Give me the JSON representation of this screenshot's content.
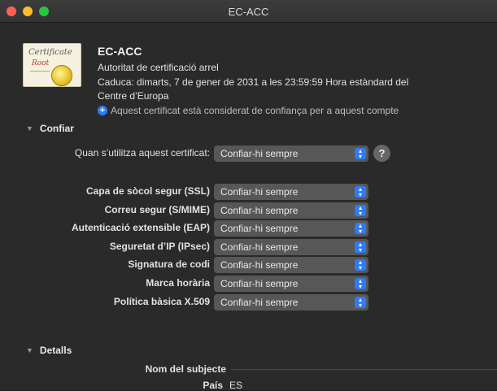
{
  "window": {
    "title": "EC-ACC"
  },
  "certificate": {
    "icon": {
      "script_line1": "Certificate",
      "script_line2": "Root",
      "name": "certificate-icon"
    },
    "name": "EC-ACC",
    "type": "Autoritat de certificació arrel",
    "expires": "Caduca: dimarts, 7 de gener de 2031 a les 23:59:59 Hora estàndard del",
    "expires_cont": "Centre d’Europa",
    "trust_note": "Aquest certificat està considerat de confiança per a aquest compte"
  },
  "trust": {
    "section_title": "Confiar",
    "when_using_label": "Quan s’utilitza aquest certificat:",
    "when_using_value": "Confiar-hi sempre",
    "help_label": "?",
    "rows": [
      {
        "label": "Capa de sòcol segur (SSL)",
        "value": "Confiar-hi sempre"
      },
      {
        "label": "Correu segur (S/MIME)",
        "value": "Confiar-hi sempre"
      },
      {
        "label": "Autenticació extensible (EAP)",
        "value": "Confiar-hi sempre"
      },
      {
        "label": "Seguretat d’IP (IPsec)",
        "value": "Confiar-hi sempre"
      },
      {
        "label": "Signatura de codi",
        "value": "Confiar-hi sempre"
      },
      {
        "label": "Marca horària",
        "value": "Confiar-hi sempre"
      },
      {
        "label": "Política bàsica X.509",
        "value": "Confiar-hi sempre"
      }
    ]
  },
  "details": {
    "section_title": "Detalls",
    "subject_label": "Nom del subjecte",
    "country_label": "País",
    "country_value": "ES"
  },
  "colors": {
    "accent": "#2f7bf5",
    "close": "#fe5f57",
    "minimize": "#febc2e",
    "maximize": "#28c840"
  }
}
